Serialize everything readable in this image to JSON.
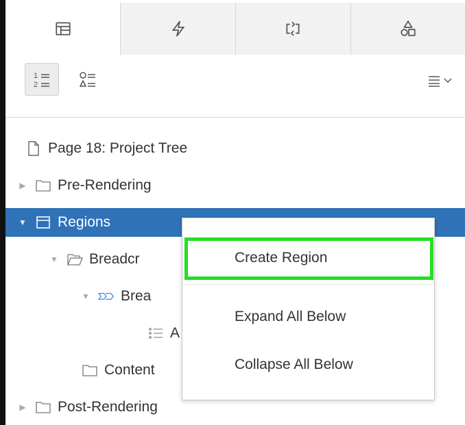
{
  "tabs": [
    {
      "icon": "layout-icon"
    },
    {
      "icon": "lightning-icon"
    },
    {
      "icon": "sync-arrows-icon"
    },
    {
      "icon": "shapes-icon"
    }
  ],
  "toolbar": {
    "ordered_list_view": {
      "icon": "numbered-list-icon",
      "lines": [
        "1",
        "2"
      ]
    },
    "shapes_list_view": {
      "icon": "shape-list-icon"
    },
    "menu": {
      "icon": "menu-dropdown-icon"
    }
  },
  "tree": {
    "page": "Page 18: Project Tree",
    "pre_rendering": "Pre-Rendering",
    "regions": "Regions",
    "breadcrumb": "Breadcr",
    "breadcrumb_child": "Brea",
    "list_child": "A",
    "content": "Content",
    "post_rendering": "Post-Rendering"
  },
  "context_menu": {
    "items": [
      "Create Region",
      "Expand All Below",
      "Collapse All Below"
    ],
    "highlighted": "Create Region"
  },
  "colors": {
    "selection": "#2f72b8",
    "highlight_box": "#22e022"
  }
}
